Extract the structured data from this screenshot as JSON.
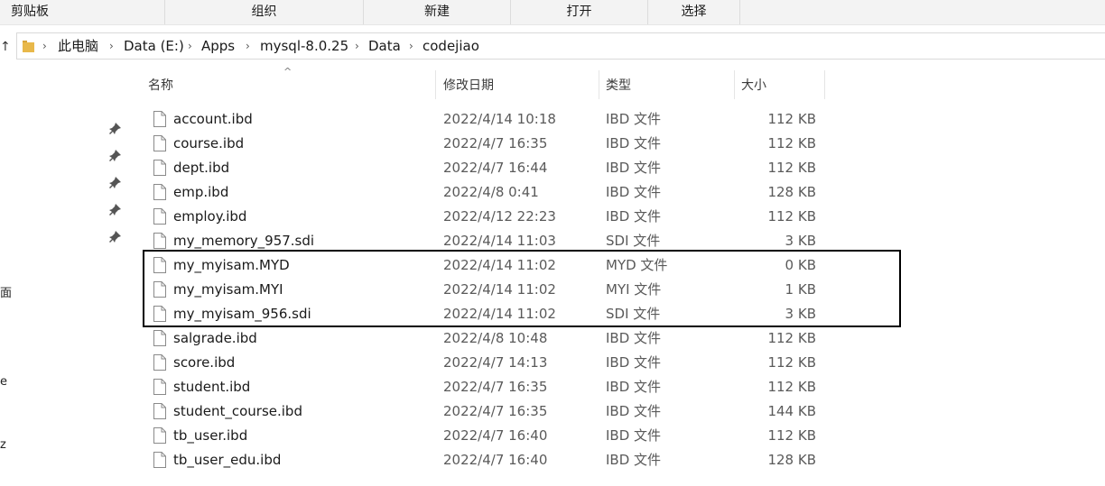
{
  "ribbon": {
    "groups": [
      "剪贴板",
      "组织",
      "新建",
      "打开",
      "选择"
    ]
  },
  "address_bar": {
    "nav_up_glyph": "↑",
    "breadcrumbs": [
      "此电脑",
      "Data (E:)",
      "Apps",
      "mysql-8.0.25",
      "Data",
      "codejiao"
    ]
  },
  "left_pane": {
    "fragments": [
      "面",
      "e",
      "z"
    ]
  },
  "columns": {
    "name": "名称",
    "date": "修改日期",
    "type": "类型",
    "size": "大小"
  },
  "files": [
    {
      "name": "account.ibd",
      "date": "2022/4/14 10:18",
      "type": "IBD 文件",
      "size": "112 KB"
    },
    {
      "name": "course.ibd",
      "date": "2022/4/7 16:35",
      "type": "IBD 文件",
      "size": "112 KB"
    },
    {
      "name": "dept.ibd",
      "date": "2022/4/7 16:44",
      "type": "IBD 文件",
      "size": "112 KB"
    },
    {
      "name": "emp.ibd",
      "date": "2022/4/8 0:41",
      "type": "IBD 文件",
      "size": "128 KB"
    },
    {
      "name": "employ.ibd",
      "date": "2022/4/12 22:23",
      "type": "IBD 文件",
      "size": "112 KB"
    },
    {
      "name": "my_memory_957.sdi",
      "date": "2022/4/14 11:03",
      "type": "SDI 文件",
      "size": "3 KB"
    },
    {
      "name": "my_myisam.MYD",
      "date": "2022/4/14 11:02",
      "type": "MYD 文件",
      "size": "0 KB"
    },
    {
      "name": "my_myisam.MYI",
      "date": "2022/4/14 11:02",
      "type": "MYI 文件",
      "size": "1 KB"
    },
    {
      "name": "my_myisam_956.sdi",
      "date": "2022/4/14 11:02",
      "type": "SDI 文件",
      "size": "3 KB"
    },
    {
      "name": "salgrade.ibd",
      "date": "2022/4/8 10:48",
      "type": "IBD 文件",
      "size": "112 KB"
    },
    {
      "name": "score.ibd",
      "date": "2022/4/7 14:13",
      "type": "IBD 文件",
      "size": "112 KB"
    },
    {
      "name": "student.ibd",
      "date": "2022/4/7 16:35",
      "type": "IBD 文件",
      "size": "112 KB"
    },
    {
      "name": "student_course.ibd",
      "date": "2022/4/7 16:35",
      "type": "IBD 文件",
      "size": "144 KB"
    },
    {
      "name": "tb_user.ibd",
      "date": "2022/4/7 16:40",
      "type": "IBD 文件",
      "size": "112 KB"
    },
    {
      "name": "tb_user_edu.ibd",
      "date": "2022/4/7 16:40",
      "type": "IBD 文件",
      "size": "128 KB"
    }
  ],
  "colors": {
    "folder": "#e8b84a",
    "highlight_border": "#000000"
  }
}
